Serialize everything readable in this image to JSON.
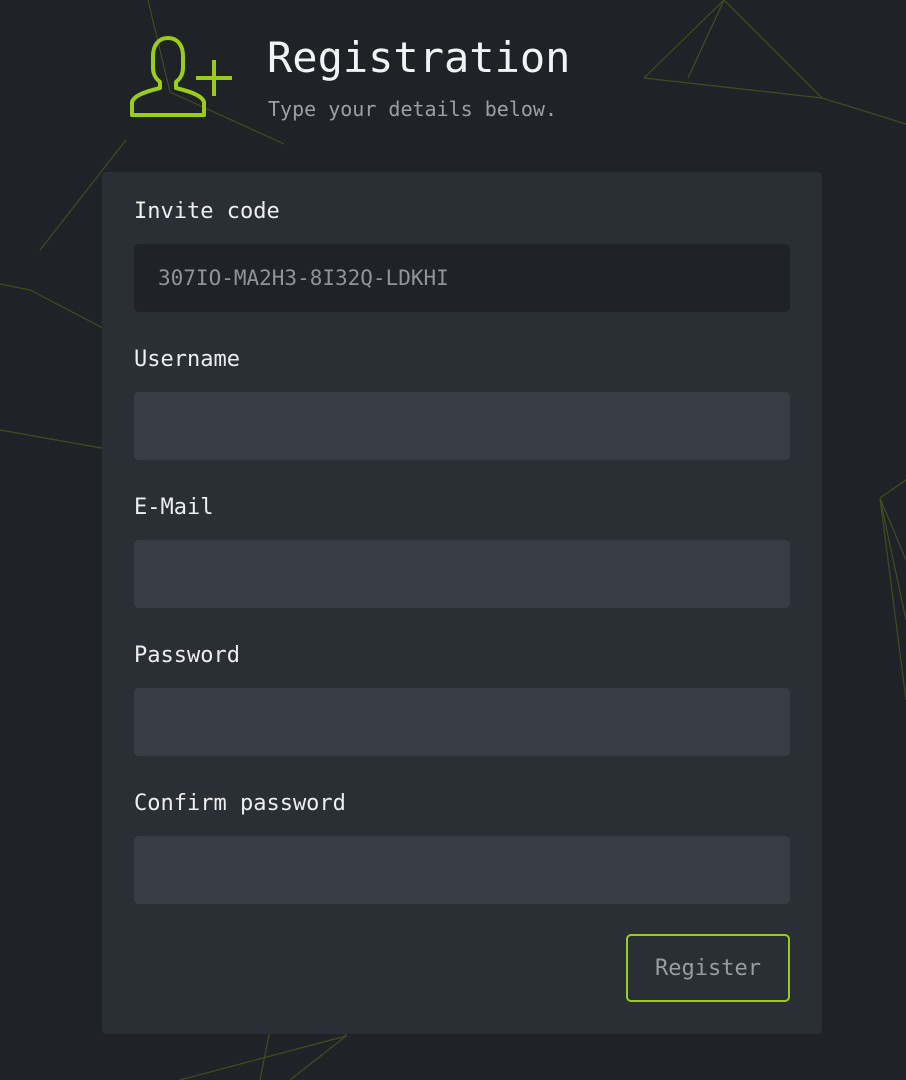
{
  "colors": {
    "accent": "#9acd1a",
    "background": "#1f2227",
    "card": "#2a2e35",
    "input": "#383d45"
  },
  "header": {
    "icon": "user-plus-icon",
    "title": "Registration",
    "subtitle": "Type your details below."
  },
  "form": {
    "invite_code": {
      "label": "Invite code",
      "value": "307IO-MA2H3-8I32Q-LDKHI"
    },
    "username": {
      "label": "Username",
      "value": ""
    },
    "email": {
      "label": "E-Mail",
      "value": ""
    },
    "password": {
      "label": "Password",
      "value": ""
    },
    "confirm_password": {
      "label": "Confirm password",
      "value": ""
    },
    "submit_label": "Register"
  }
}
